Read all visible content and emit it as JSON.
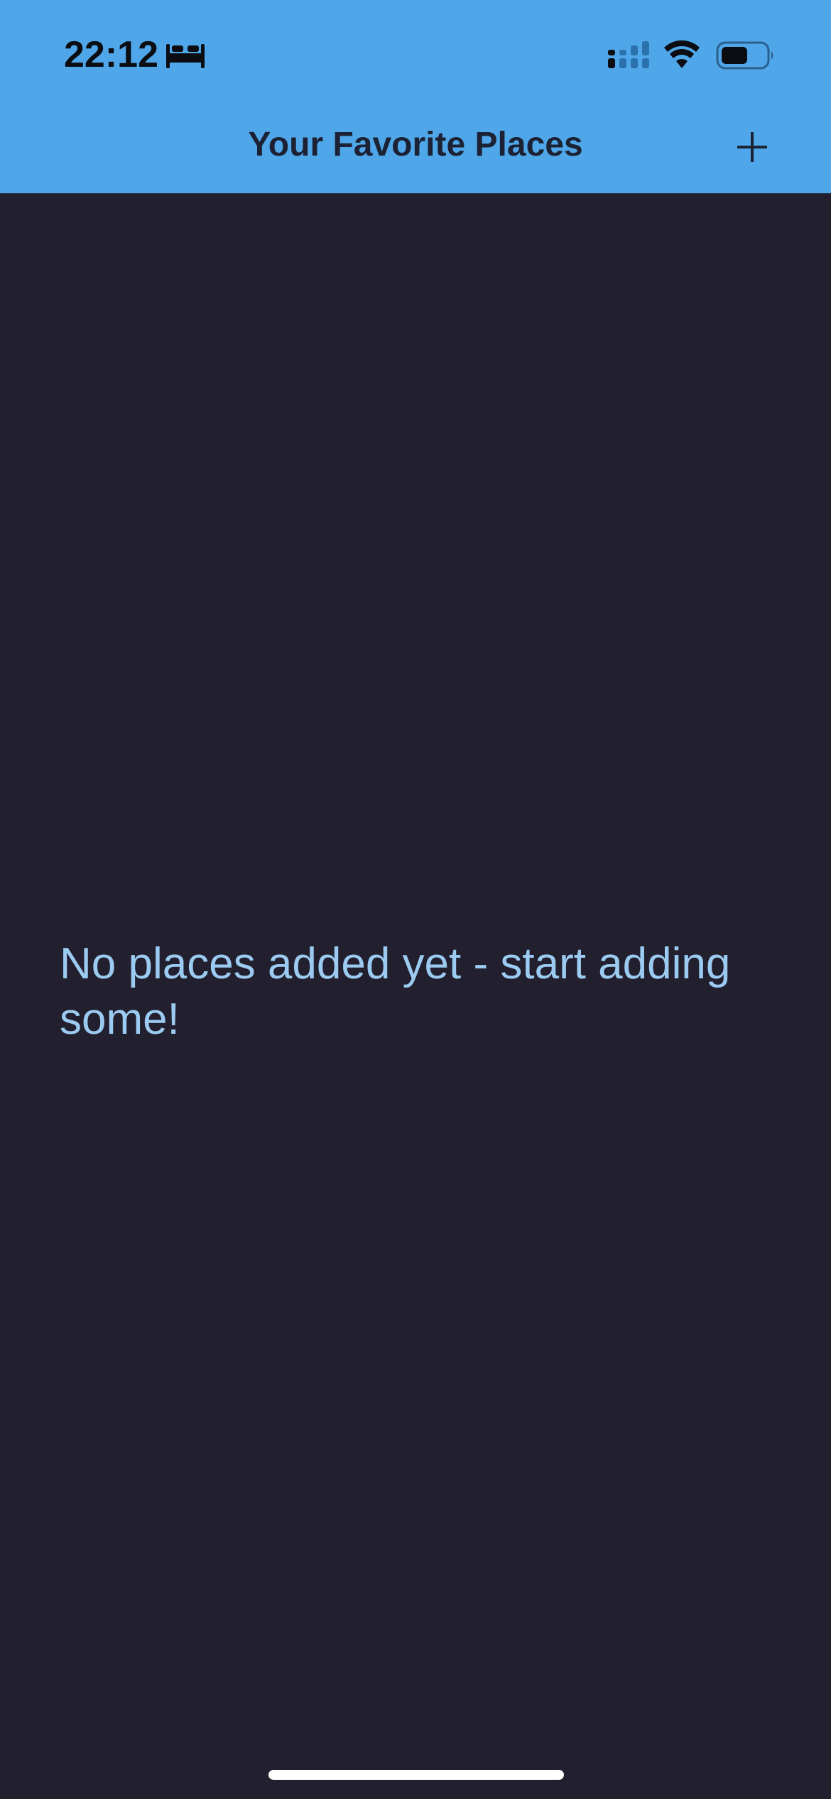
{
  "status_bar": {
    "time": "22:12",
    "focus_icon": "bed-icon",
    "signal_icon": "cellular-signal-icon",
    "wifi_icon": "wifi-icon",
    "battery_icon": "battery-icon"
  },
  "app_bar": {
    "title": "Your Favorite Places",
    "add_icon": "plus-icon",
    "background_color": "#4fa7ea"
  },
  "main": {
    "empty_message": "No places added yet - start adding some!",
    "background_color": "#221f2f",
    "text_color": "#9ccbf2"
  }
}
